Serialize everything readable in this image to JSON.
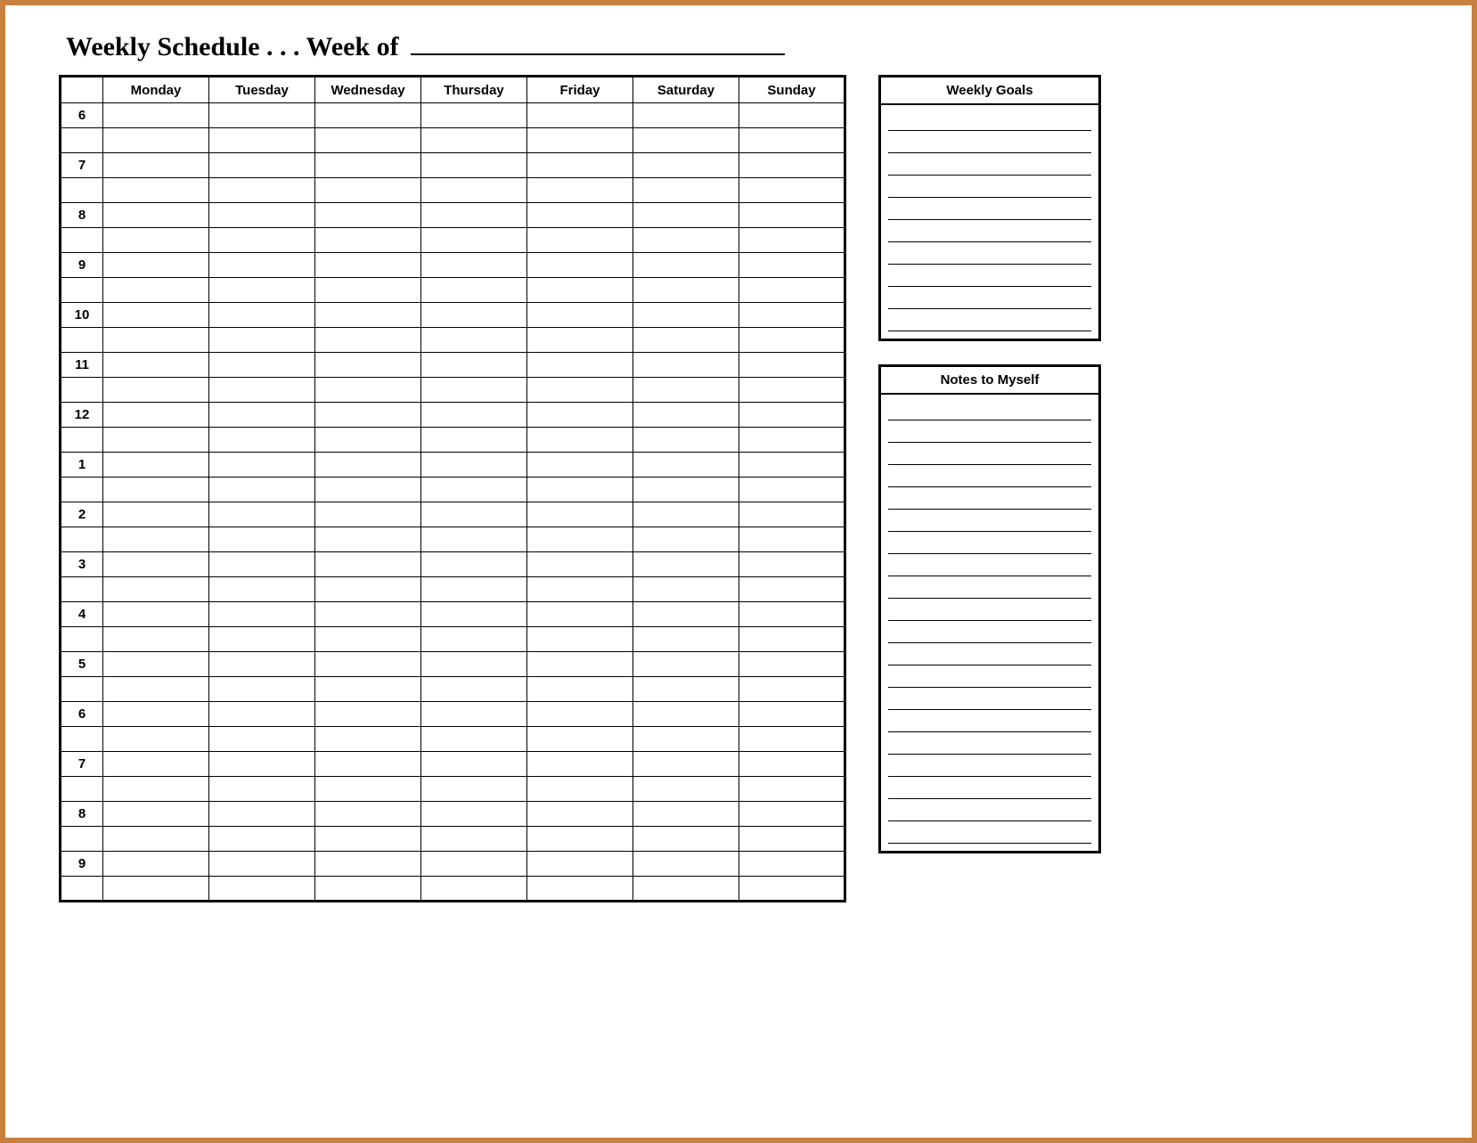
{
  "title": {
    "label": "Weekly Schedule . . . Week of "
  },
  "schedule": {
    "days": [
      "Monday",
      "Tuesday",
      "Wednesday",
      "Thursday",
      "Friday",
      "Saturday",
      "Sunday"
    ],
    "hours": [
      "6",
      "7",
      "8",
      "9",
      "10",
      "11",
      "12",
      "1",
      "2",
      "3",
      "4",
      "5",
      "6",
      "7",
      "8",
      "9"
    ],
    "slots_per_hour": 2
  },
  "sidebar": {
    "goals": {
      "title": "Weekly Goals",
      "lines": 10
    },
    "notes": {
      "title": "Notes to Myself",
      "lines": 20
    }
  }
}
